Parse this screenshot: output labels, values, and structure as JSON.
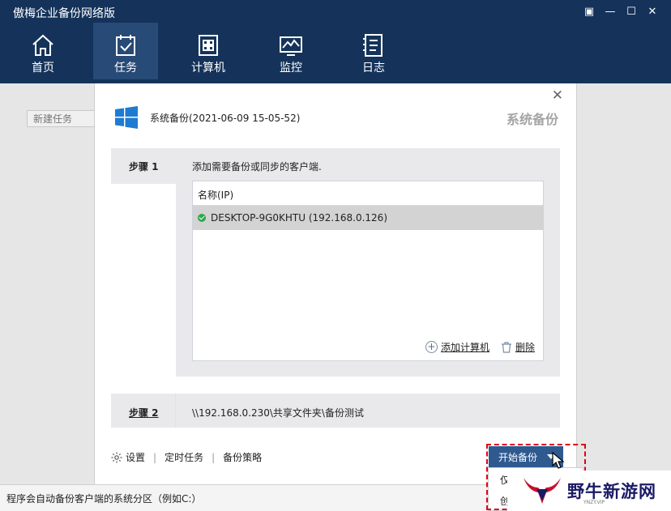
{
  "app": {
    "title": "傲梅企业备份网络版",
    "window_controls": [
      "▣",
      "—",
      "☐",
      "✕"
    ]
  },
  "nav": {
    "items": [
      {
        "label": "首页",
        "icon": "home-icon"
      },
      {
        "label": "任务",
        "icon": "task-icon",
        "active": true
      },
      {
        "label": "计算机",
        "icon": "computer-icon"
      },
      {
        "label": "监控",
        "icon": "monitor-icon"
      },
      {
        "label": "日志",
        "icon": "log-icon"
      }
    ]
  },
  "background": {
    "new_task_placeholder": "新建任务",
    "status_text": "程序会自动备份客户端的系统分区（例如C:）"
  },
  "dialog": {
    "close": "✕",
    "subtitle": "系统备份(2021-06-09 15-05-52)",
    "title_right": "系统备份",
    "step1": {
      "label": "步骤 1",
      "description": "添加需要备份或同步的客户端.",
      "list_header": "名称(IP)",
      "rows": [
        {
          "name": "DESKTOP-9G0KHTU (192.168.0.126)",
          "status": "online"
        }
      ],
      "add_computer": "添加计算机",
      "delete": "删除"
    },
    "step2": {
      "label": "步骤 2",
      "path": "\\\\192.168.0.230\\共享文件夹\\备份测试"
    },
    "footer": {
      "settings": "设置",
      "schedule": "定时任务",
      "strategy": "备份策略"
    },
    "start_button": "开始备份",
    "dropdown_items": [
      "仅",
      "创"
    ]
  },
  "watermark": {
    "text": "野牛新游网",
    "sub": "YNZY.VIP"
  },
  "colors": {
    "topbar": "#15335a",
    "nav_active": "#274a76",
    "primary_button": "#2e5a90",
    "highlight": "#e0001a",
    "online_dot": "#2ea84a"
  }
}
